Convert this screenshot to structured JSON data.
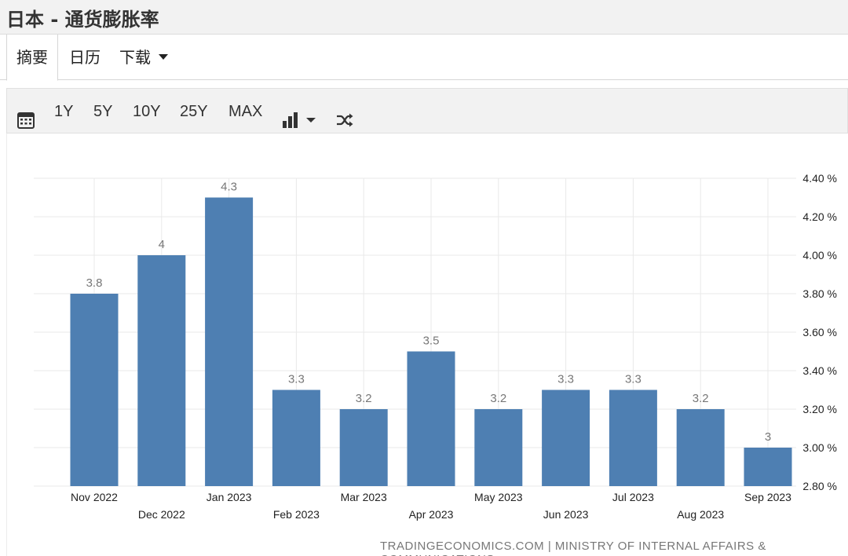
{
  "header": {
    "title": "日本 - 通货膨胀率"
  },
  "tabs": [
    {
      "label": "摘要",
      "active": true
    },
    {
      "label": "日历",
      "active": false
    },
    {
      "label": "下载",
      "active": false
    }
  ],
  "toolbar": {
    "icons": {
      "calendar": "calendar-icon",
      "chart_type": "bar-chart-icon",
      "compare": "shuffle-icon"
    },
    "ranges": [
      "1Y",
      "5Y",
      "10Y",
      "25Y",
      "MAX"
    ]
  },
  "colors": {
    "bar": "#4e7fb2",
    "grid": "#e9e9e9",
    "axis_text": "#222222",
    "data_label": "#777777"
  },
  "chart_data": {
    "type": "bar",
    "categories": [
      "Nov 2022",
      "Dec 2022",
      "Jan 2023",
      "Feb 2023",
      "Mar 2023",
      "Apr 2023",
      "May 2023",
      "Jun 2023",
      "Jul 2023",
      "Aug 2023",
      "Sep 2023"
    ],
    "values": [
      3.8,
      4,
      4.3,
      3.3,
      3.2,
      3.5,
      3.2,
      3.3,
      3.3,
      3.2,
      3
    ],
    "data_labels": [
      "3.8",
      "4",
      "4.3",
      "3.3",
      "3.2",
      "3.5",
      "3.2",
      "3.3",
      "3.3",
      "3.2",
      "3"
    ],
    "ylim": [
      2.8,
      4.4
    ],
    "yticks": [
      2.8,
      3.0,
      3.2,
      3.4,
      3.6,
      3.8,
      4.0,
      4.2,
      4.4
    ],
    "ytick_labels": [
      "2.80 %",
      "3.00 %",
      "3.20 %",
      "3.40 %",
      "3.60 %",
      "3.80 %",
      "4.00 %",
      "4.20 %",
      "4.40 %"
    ],
    "y_axis_side": "right",
    "grid": true,
    "title": "",
    "xlabel": "",
    "ylabel": ""
  },
  "footer": {
    "source": "TRADINGECONOMICS.COM | MINISTRY OF INTERNAL AFFAIRS & COMMUNICATIONS"
  }
}
